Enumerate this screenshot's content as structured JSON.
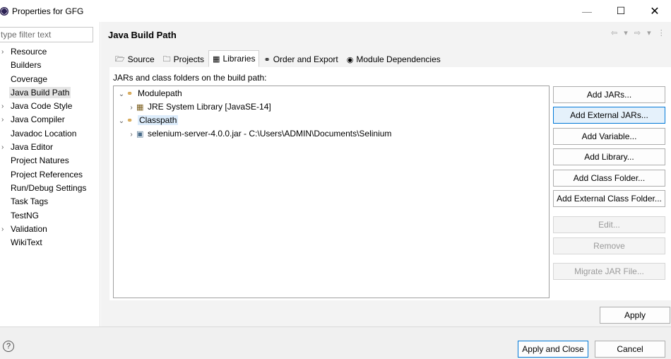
{
  "window": {
    "title": "Properties for GFG",
    "minimize_glyph": "—",
    "maximize_glyph": "☐",
    "close_glyph": "✕"
  },
  "sidebar": {
    "filter_placeholder": "type filter text",
    "items": [
      {
        "label": "Resource",
        "expandable": true
      },
      {
        "label": "Builders",
        "expandable": false
      },
      {
        "label": "Coverage",
        "expandable": false
      },
      {
        "label": "Java Build Path",
        "expandable": false,
        "selected": true
      },
      {
        "label": "Java Code Style",
        "expandable": true
      },
      {
        "label": "Java Compiler",
        "expandable": true
      },
      {
        "label": "Javadoc Location",
        "expandable": false
      },
      {
        "label": "Java Editor",
        "expandable": true
      },
      {
        "label": "Project Natures",
        "expandable": false
      },
      {
        "label": "Project References",
        "expandable": false
      },
      {
        "label": "Run/Debug Settings",
        "expandable": false
      },
      {
        "label": "Task Tags",
        "expandable": false
      },
      {
        "label": "TestNG",
        "expandable": false
      },
      {
        "label": "Validation",
        "expandable": true
      },
      {
        "label": "WikiText",
        "expandable": false
      }
    ]
  },
  "page": {
    "title": "Java Build Path",
    "nav_arrows": "⇦ ▾ ⇨ ▾ ⋮",
    "tabs": [
      {
        "label": "Source",
        "icon": "source-folder-icon",
        "glyph": "🗁"
      },
      {
        "label": "Projects",
        "icon": "projects-icon",
        "glyph": "🗀"
      },
      {
        "label": "Libraries",
        "icon": "libraries-icon",
        "glyph": "▦",
        "active": true
      },
      {
        "label": "Order and Export",
        "icon": "order-export-icon",
        "glyph": "⚭"
      },
      {
        "label": "Module Dependencies",
        "icon": "module-dependencies-icon",
        "glyph": "◉"
      }
    ],
    "content_label": "JARs and class folders on the build path:",
    "tree": {
      "modulepath": "Modulepath",
      "jre": "JRE System Library [JavaSE-14]",
      "classpath": "Classpath",
      "jar": "selenium-server-4.0.0.jar - C:\\Users\\ADMIN\\Documents\\Selinium"
    },
    "buttons": {
      "add_jars": "Add JARs...",
      "add_external_jars": "Add External JARs...",
      "add_variable": "Add Variable...",
      "add_library": "Add Library...",
      "add_class_folder": "Add Class Folder...",
      "add_external_class_folder": "Add External Class Folder...",
      "edit": "Edit...",
      "remove": "Remove",
      "migrate_jar": "Migrate JAR File..."
    },
    "apply": "Apply"
  },
  "footer": {
    "help": "?",
    "apply_and_close": "Apply and Close",
    "cancel": "Cancel"
  },
  "colors": {
    "accent": "#0078d7",
    "selection": "#dcecfb",
    "eclipse_logo": "#2c2255"
  }
}
